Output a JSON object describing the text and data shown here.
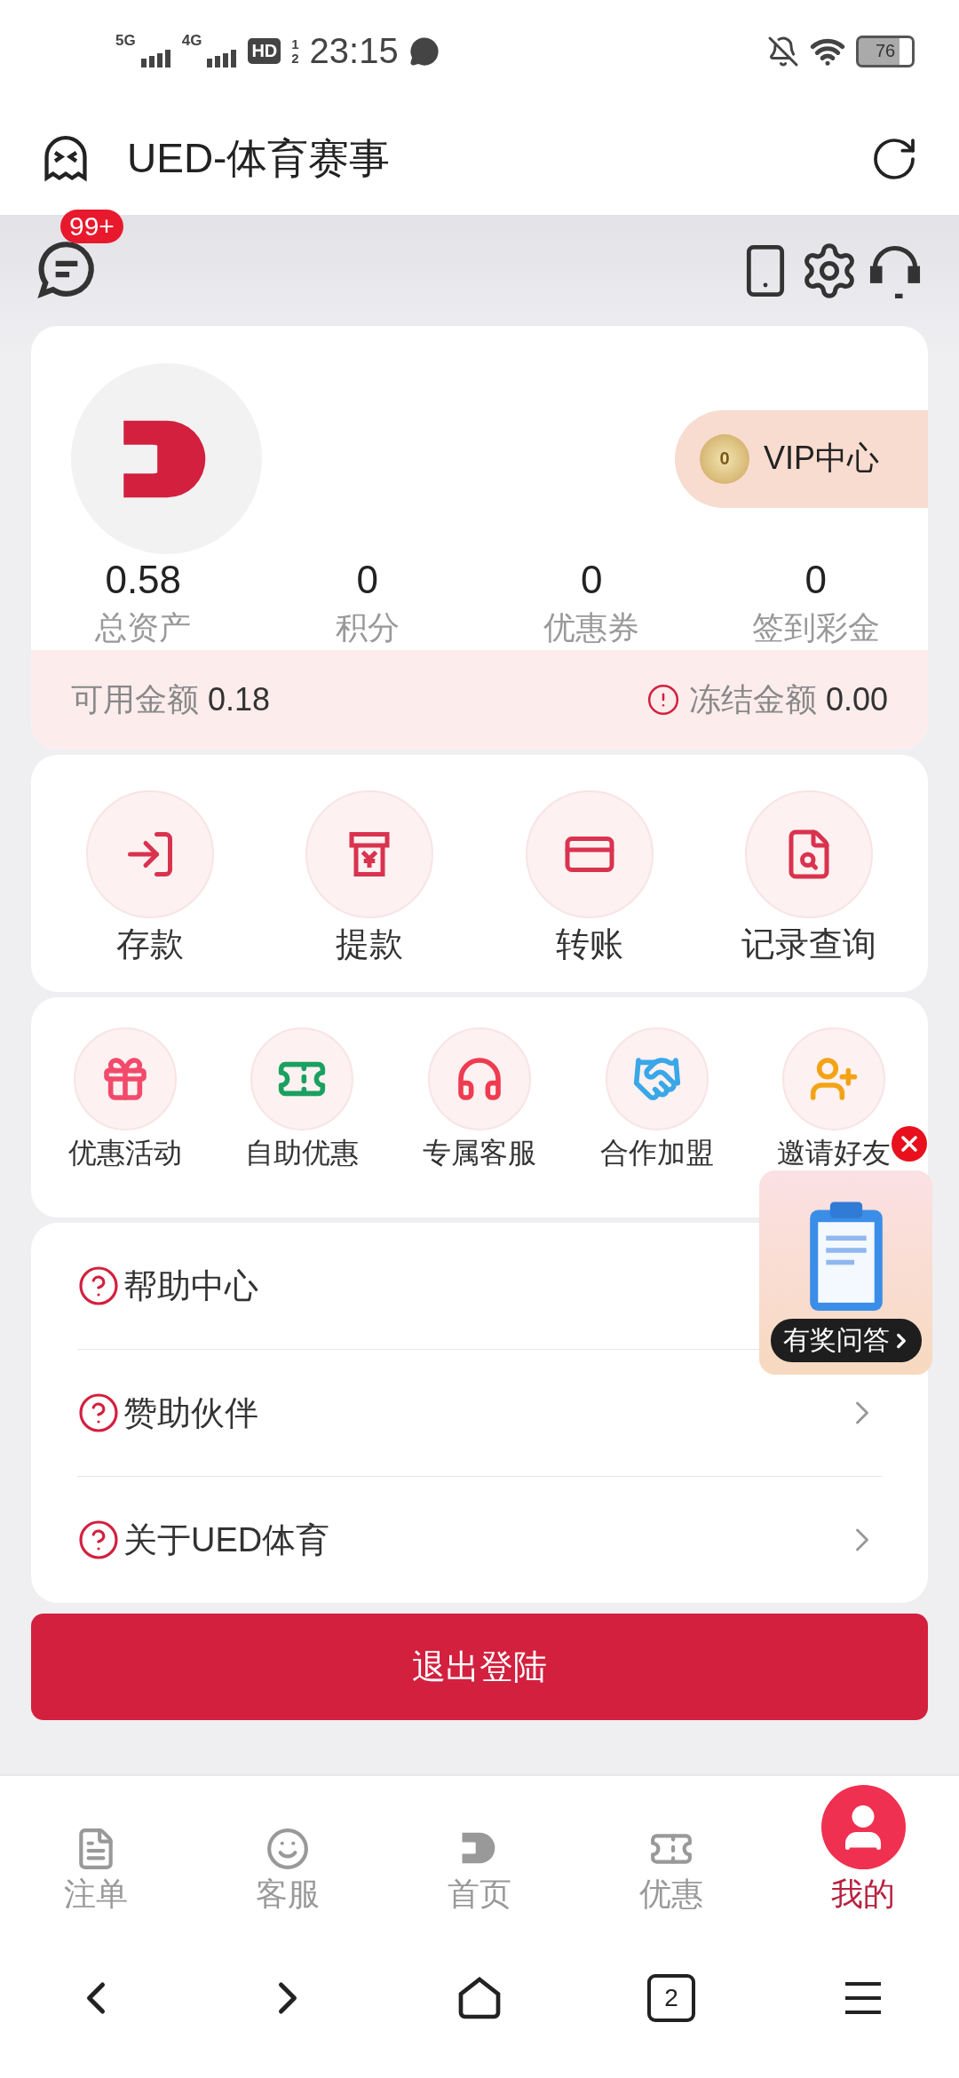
{
  "status_bar": {
    "sim1": "5G",
    "sim2": "4G",
    "hd": "HD",
    "hd_sub": [
      "1",
      "2"
    ],
    "time": "23:15",
    "battery": "76"
  },
  "header": {
    "title": "UED-体育赛事"
  },
  "top_bar": {
    "badge": "99+"
  },
  "profile": {
    "vip_label": "VIP中心",
    "vip_medal": "0",
    "stats": [
      {
        "value": "0.58",
        "label": "总资产"
      },
      {
        "value": "0",
        "label": "积分"
      },
      {
        "value": "0",
        "label": "优惠券"
      },
      {
        "value": "0",
        "label": "签到彩金"
      }
    ],
    "available_label": "可用金额",
    "available_value": "0.18",
    "frozen_label": "冻结金额",
    "frozen_value": "0.00"
  },
  "actions": [
    {
      "label": "存款"
    },
    {
      "label": "提款"
    },
    {
      "label": "转账"
    },
    {
      "label": "记录查询"
    }
  ],
  "services": [
    {
      "label": "优惠活动"
    },
    {
      "label": "自助优惠"
    },
    {
      "label": "专属客服"
    },
    {
      "label": "合作加盟"
    },
    {
      "label": "邀请好友"
    }
  ],
  "menu": [
    {
      "label": "帮助中心"
    },
    {
      "label": "赞助伙伴"
    },
    {
      "label": "关于UED体育"
    }
  ],
  "logout": "退出登陆",
  "floating_ad": {
    "label": "有奖问答"
  },
  "bottom_nav": [
    {
      "label": "注单",
      "selected": false
    },
    {
      "label": "客服",
      "selected": false
    },
    {
      "label": "首页",
      "selected": false
    },
    {
      "label": "优惠",
      "selected": false
    },
    {
      "label": "我的",
      "selected": true
    }
  ],
  "system_nav": {
    "tabs_count": "2"
  }
}
